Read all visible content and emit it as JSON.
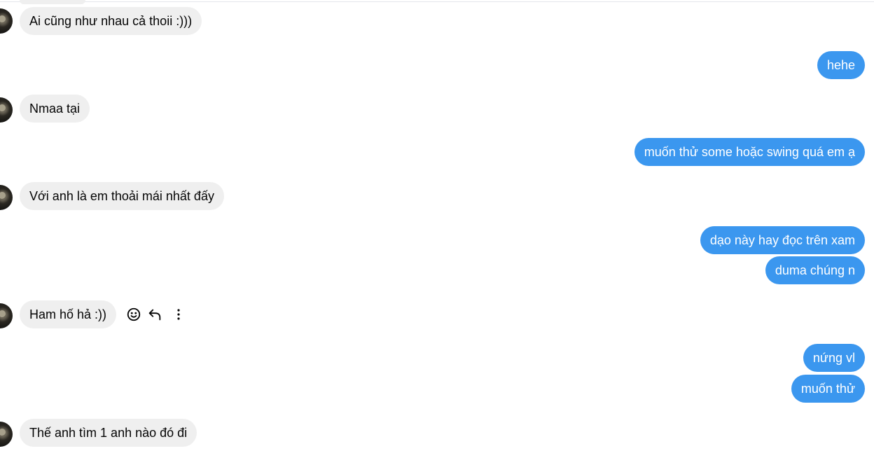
{
  "messages": [
    {
      "side": "in",
      "text": "Ai cũng như nhau cả thoii :)))"
    },
    {
      "side": "out",
      "text": "hehe"
    },
    {
      "side": "in",
      "text": "Nmaa tại"
    },
    {
      "side": "out",
      "text": "muốn thử some hoặc swing quá em ạ"
    },
    {
      "side": "in",
      "text": "Với anh là em thoải mái nhất đấy"
    },
    {
      "side": "out",
      "text": "dạo này hay đọc trên xam"
    },
    {
      "side": "out",
      "text": "duma chúng n"
    },
    {
      "side": "in",
      "text": "Ham hố hả :))"
    },
    {
      "side": "out",
      "text": "nứng vl"
    },
    {
      "side": "out",
      "text": "muốn thử"
    },
    {
      "side": "in",
      "text": "Thế anh tìm 1 anh nào đó đi"
    }
  ],
  "actions": {
    "react_icon": "smile-icon",
    "reply_icon": "reply-arrow-icon",
    "more_icon": "vertical-dots-icon"
  },
  "colors": {
    "incoming_bubble": "#efefef",
    "outgoing_bubble": "#3b97ef",
    "incoming_text": "#050505",
    "outgoing_text": "#ffffff"
  }
}
